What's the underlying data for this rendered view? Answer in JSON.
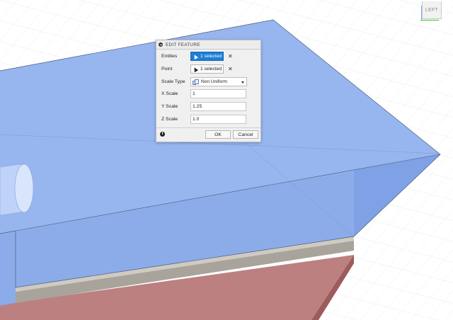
{
  "dialog": {
    "title": "EDIT FEATURE",
    "entities": {
      "label": "Entities",
      "value": "1 selected"
    },
    "point": {
      "label": "Point",
      "value": "1 selected"
    },
    "scale_type": {
      "label": "Scale Type",
      "value": "Non Uniform"
    },
    "x_scale": {
      "label": "X Scale",
      "value": "1"
    },
    "y_scale": {
      "label": "Y Scale",
      "value": "1.25"
    },
    "z_scale": {
      "label": "Z Scale",
      "value": "1.0"
    },
    "clear_symbol": "✕",
    "info_symbol": "i",
    "ok_label": "OK",
    "cancel_label": "Cancel"
  },
  "viewcube": {
    "face_label": "LEFT"
  },
  "colors": {
    "body_top": "#8fb0f0",
    "body_side": "#8aabe9",
    "edge_strip": "#a7a39b",
    "base_solid": "#b36a6a",
    "grid": "#d9dde3",
    "selected_button": "#1d7fd5"
  }
}
